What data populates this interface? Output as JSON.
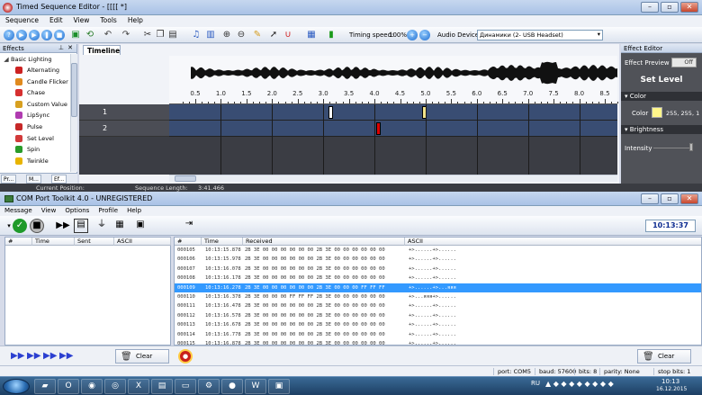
{
  "window1": {
    "title": "Timed Sequence Editor - [[[[ *]",
    "menu": [
      "Sequence",
      "Edit",
      "View",
      "Tools",
      "Help"
    ],
    "toolbar": {
      "timing_speed_label": "Timing speed:",
      "timing_speed_value": "100%",
      "audio_device_label": "Audio Device",
      "audio_device_value": "Динамики (2- USB Headset)"
    },
    "effects_panel": {
      "title": "Effects",
      "group": "Basic Lighting",
      "items": [
        {
          "label": "Alternating",
          "icon": "alternating-icon",
          "color": "#cc2222"
        },
        {
          "label": "Candle Flicker",
          "icon": "candle-icon",
          "color": "#e08a1e"
        },
        {
          "label": "Chase",
          "icon": "chase-icon",
          "color": "#d63030"
        },
        {
          "label": "Custom Value",
          "icon": "custom-value-icon",
          "color": "#d8a020"
        },
        {
          "label": "LipSync",
          "icon": "lipsync-icon",
          "color": "#b03bb0"
        },
        {
          "label": "Pulse",
          "icon": "pulse-icon",
          "color": "#c62828"
        },
        {
          "label": "Set Level",
          "icon": "set-level-icon",
          "color": "#d23a3a"
        },
        {
          "label": "Spin",
          "icon": "spin-icon",
          "color": "#2a9b2a"
        },
        {
          "label": "Twinkle",
          "icon": "twinkle-icon",
          "color": "#e8b400"
        }
      ],
      "tabs": [
        "Pr...",
        "M...",
        "Ef..."
      ]
    },
    "timeline": {
      "tab_label": "Timeline",
      "ticks": [
        "0.5",
        "1.0",
        "1.5",
        "2.0",
        "2.5",
        "3.0",
        "3.5",
        "4.0",
        "4.5",
        "5.0",
        "5.5",
        "6.0",
        "6.5",
        "7.0",
        "7.5",
        "8.0",
        "8.5"
      ],
      "rows": [
        {
          "label": "1",
          "events": [
            {
              "time": 3.13,
              "color": "#ffffff"
            },
            {
              "time": 4.97,
              "color": "#f2e38a"
            }
          ]
        },
        {
          "label": "2",
          "events": [
            {
              "time": 4.07,
              "color": "#dd0000"
            }
          ]
        }
      ]
    },
    "effect_editor": {
      "title": "Effect Editor",
      "preview_label": "Effect Preview",
      "preview_toggle": "Off",
      "effect_name": "Set Level",
      "color_section": "Color",
      "color_label": "Color",
      "color_value": "255, 255, 1",
      "color_swatch": "#fff68a",
      "brightness_section": "Brightness",
      "intensity_label": "Intensity"
    },
    "status": {
      "current_position_label": "Current Position:",
      "sequence_length_label": "Sequence Length:",
      "sequence_length_value": "3:41.466"
    }
  },
  "window2": {
    "title": "COM Port Toolkit 4.0 - UNREGISTERED",
    "menu": [
      "Message",
      "View",
      "Options",
      "Profile",
      "Help"
    ],
    "clock": "10:13:37",
    "left_headers": [
      "#",
      "Time",
      "Sent",
      "ASCII"
    ],
    "right_headers": [
      "#",
      "Time",
      "Received",
      "ASCII"
    ],
    "rows": [
      {
        "n": "000105",
        "t": "10:13:15.878",
        "hex": "2B 3E 00 00 00 00 00 00 2B 3E 00 00 00 00 00 00",
        "ascii": "+>......+>......",
        "sel": false
      },
      {
        "n": "000106",
        "t": "10:13:15.978",
        "hex": "2B 3E 00 00 00 00 00 00 2B 3E 00 00 00 00 00 00",
        "ascii": "+>......+>......",
        "sel": false
      },
      {
        "n": "000107",
        "t": "10:13:16.078",
        "hex": "2B 3E 00 00 00 00 00 00 2B 3E 00 00 00 00 00 00",
        "ascii": "+>......+>......",
        "sel": false
      },
      {
        "n": "000108",
        "t": "10:13:16.178",
        "hex": "2B 3E 00 00 00 00 00 00 2B 3E 00 00 00 00 00 00",
        "ascii": "+>......+>......",
        "sel": false
      },
      {
        "n": "000109",
        "t": "10:13:16.278",
        "hex": "2B 3E 00 00 00 00 00 00 2B 3E 00 00 00 FF FF FF",
        "ascii": "+>......+>...яяя",
        "sel": true
      },
      {
        "n": "000110",
        "t": "10:13:16.378",
        "hex": "2B 3E 00 00 00 FF FF FF 2B 3E 00 00 00 00 00 00",
        "ascii": "+>...яяя+>......",
        "sel": false
      },
      {
        "n": "000111",
        "t": "10:13:16.478",
        "hex": "2B 3E 00 00 00 00 00 00 2B 3E 00 00 00 00 00 00",
        "ascii": "+>......+>......",
        "sel": false
      },
      {
        "n": "000112",
        "t": "10:13:16.578",
        "hex": "2B 3E 00 00 00 00 00 00 2B 3E 00 00 00 00 00 00",
        "ascii": "+>......+>......",
        "sel": false
      },
      {
        "n": "000113",
        "t": "10:13:16.678",
        "hex": "2B 3E 00 00 00 00 00 00 2B 3E 00 00 00 00 00 00",
        "ascii": "+>......+>......",
        "sel": false
      },
      {
        "n": "000114",
        "t": "10:13:16.778",
        "hex": "2B 3E 00 00 00 00 00 00 2B 3E 00 00 00 00 00 00",
        "ascii": "+>......+>......",
        "sel": false
      },
      {
        "n": "000115",
        "t": "10:13:16.878",
        "hex": "2B 3E 00 00 00 00 00 00 2B 3E 00 00 00 00 00 00",
        "ascii": "+>......+>......",
        "sel": false
      }
    ],
    "clear_label": "Clear",
    "status": {
      "port": "port: COM5",
      "baud": "baud: 57600",
      "bits": "bits: 8",
      "parity": "parity: None",
      "stop": "stop bits: 1"
    }
  },
  "taskbar": {
    "lang": "RU",
    "time": "10:13",
    "date": "16.12.2015"
  }
}
